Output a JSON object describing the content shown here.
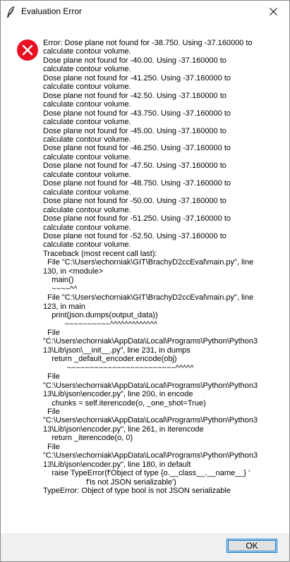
{
  "window": {
    "title": "Evaluation Error",
    "close_glyph": "✕"
  },
  "icons": {
    "app": "feather-icon",
    "error": "error-icon",
    "error_color": "#e81123"
  },
  "message": {
    "lines": [
      "Error: Dose plane not found for -38.750. Using -37.160000 to",
      "calculate contour volume.",
      "Dose plane not found for -40.00. Using -37.160000 to",
      "calculate contour volume.",
      "Dose plane not found for -41.250. Using -37.160000 to",
      "calculate contour volume.",
      "Dose plane not found for -42.50. Using -37.160000 to",
      "calculate contour volume.",
      "Dose plane not found for -43.750. Using -37.160000 to",
      "calculate contour volume.",
      "Dose plane not found for -45.00. Using -37.160000 to",
      "calculate contour volume.",
      "Dose plane not found for -46.250. Using -37.160000 to",
      "calculate contour volume.",
      "Dose plane not found for -47.50. Using -37.160000 to",
      "calculate contour volume.",
      "Dose plane not found for -48.750. Using -37.160000 to",
      "calculate contour volume.",
      "Dose plane not found for -50.00. Using -37.160000 to",
      "calculate contour volume.",
      "Dose plane not found for -51.250. Using -37.160000 to",
      "calculate contour volume.",
      "Dose plane not found for -52.50. Using -37.160000 to",
      "calculate contour volume.",
      "Traceback (most recent call last):",
      "  File \"C:\\Users\\echorniak\\GIT\\BrachyD2ccEval\\main.py\", line",
      "130, in <module>",
      "    main()",
      "    ~~~~^^",
      "  File \"C:\\Users\\echorniak\\GIT\\BrachyD2ccEval\\main.py\", line",
      "123, in main",
      "    print(json.dumps(output_data))",
      "          ~~~~~~~~~~^^^^^^^^^^^^^",
      "  File",
      "\"C:\\Users\\echorniak\\AppData\\Local\\Programs\\Python\\Python3",
      "13\\Lib\\json\\__init__.py\", line 231, in dumps",
      "    return _default_encoder.encode(obj)",
      "           ~~~~~~~~~~~~~~~~~~~~~~~~^^^^^",
      "  File",
      "\"C:\\Users\\echorniak\\AppData\\Local\\Programs\\Python\\Python3",
      "13\\Lib\\json\\encoder.py\", line 200, in encode",
      "    chunks = self.iterencode(o, _one_shot=True)",
      "  File",
      "\"C:\\Users\\echorniak\\AppData\\Local\\Programs\\Python\\Python3",
      "13\\Lib\\json\\encoder.py\", line 261, in iterencode",
      "    return _iterencode(o, 0)",
      "  File",
      "\"C:\\Users\\echorniak\\AppData\\Local\\Programs\\Python\\Python3",
      "13\\Lib\\json\\encoder.py\", line 180, in default",
      "    raise TypeError(f'Object of type {o.__class__.__name__} '",
      "                    f'is not JSON serializable')",
      "TypeError: Object of type bool is not JSON serializable"
    ]
  },
  "footer": {
    "ok_label": "OK"
  }
}
